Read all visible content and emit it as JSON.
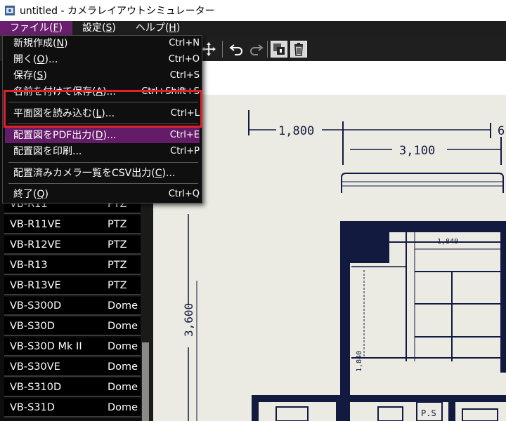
{
  "window": {
    "title": "untitled - カメラレイアウトシミュレーター"
  },
  "menubar": [
    {
      "label": "ファイル(",
      "mnemonic": "F",
      "close": ")"
    },
    {
      "label": "設定(",
      "mnemonic": "S",
      "close": ")"
    },
    {
      "label": "ヘルプ(",
      "mnemonic": "H",
      "close": ")"
    }
  ],
  "file_menu": [
    {
      "pre": "新規作成(",
      "mn": "N",
      "post": ")",
      "shortcut": "Ctrl+N"
    },
    {
      "pre": "開く(",
      "mn": "O",
      "post": ")...",
      "shortcut": "Ctrl+O"
    },
    {
      "pre": "保存(",
      "mn": "S",
      "post": ")",
      "shortcut": "Ctrl+S"
    },
    {
      "pre": "名前を付けて保存(",
      "mn": "A",
      "post": ")...",
      "shortcut": "Ctrl+Shift+S"
    },
    {
      "pre": "平面図を読み込む(",
      "mn": "L",
      "post": ")...",
      "shortcut": "Ctrl+L"
    },
    {
      "pre": "配置図をPDF出力(",
      "mn": "D",
      "post": ")...",
      "shortcut": "Ctrl+E"
    },
    {
      "pre": "配置図を印刷...",
      "mn": "",
      "post": "",
      "shortcut": "Ctrl+P"
    },
    {
      "pre": "配置済みカメラ一覧をCSV出力(",
      "mn": "C",
      "post": ")...",
      "shortcut": ""
    },
    {
      "pre": "終了(",
      "mn": "Q",
      "post": ")",
      "shortcut": "Ctrl+Q"
    }
  ],
  "camera_list": [
    {
      "model": "VB-R11",
      "type": "PTZ"
    },
    {
      "model": "VB-R11VE",
      "type": "PTZ"
    },
    {
      "model": "VB-R12VE",
      "type": "PTZ"
    },
    {
      "model": "VB-R13",
      "type": "PTZ"
    },
    {
      "model": "VB-R13VE",
      "type": "PTZ"
    },
    {
      "model": "VB-S300D",
      "type": "Dome"
    },
    {
      "model": "VB-S30D",
      "type": "Dome"
    },
    {
      "model": "VB-S30D Mk II",
      "type": "Dome"
    },
    {
      "model": "VB-S30VE",
      "type": "Dome"
    },
    {
      "model": "VB-S310D",
      "type": "Dome"
    },
    {
      "model": "VB-S31D",
      "type": "Dome"
    }
  ],
  "floorplan": {
    "dim_1": "1,800",
    "dim_2": "3,100",
    "dim_3": "3,600",
    "dim_4": "1,840",
    "dim_5": "1,840",
    "dim_6": "6",
    "label_ps": "P.S"
  },
  "colors": {
    "menu_highlight": "#641c69",
    "callout": "#e0212a",
    "ink": "#131a3f"
  }
}
